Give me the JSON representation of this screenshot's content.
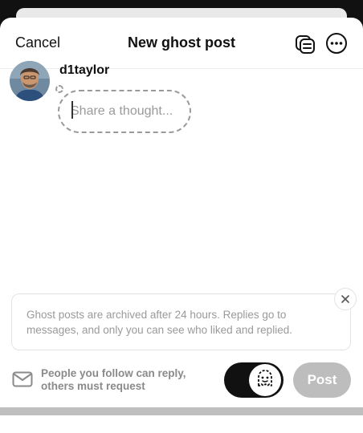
{
  "header": {
    "cancel_label": "Cancel",
    "title": "New ghost post",
    "drafts_icon": "drafts-icon",
    "more_icon": "more-icon"
  },
  "composer": {
    "username": "d1taylor",
    "placeholder": "Share a thought...",
    "value": ""
  },
  "notice": {
    "text": "Ghost posts are archived after 24 hours. Replies go to messages, and only you can see who liked and replied.",
    "close_icon": "close-icon"
  },
  "footer": {
    "reply_setting_line1": "People you follow can reply,",
    "reply_setting_line2": "others must request",
    "reply_icon": "envelope-icon",
    "ghost_toggle_on": true,
    "ghost_icon": "ghost-icon",
    "post_label": "Post"
  },
  "colors": {
    "accent_dark": "#111111",
    "post_disabled": "#bdbdbd",
    "muted_text": "#9a9a9a"
  }
}
